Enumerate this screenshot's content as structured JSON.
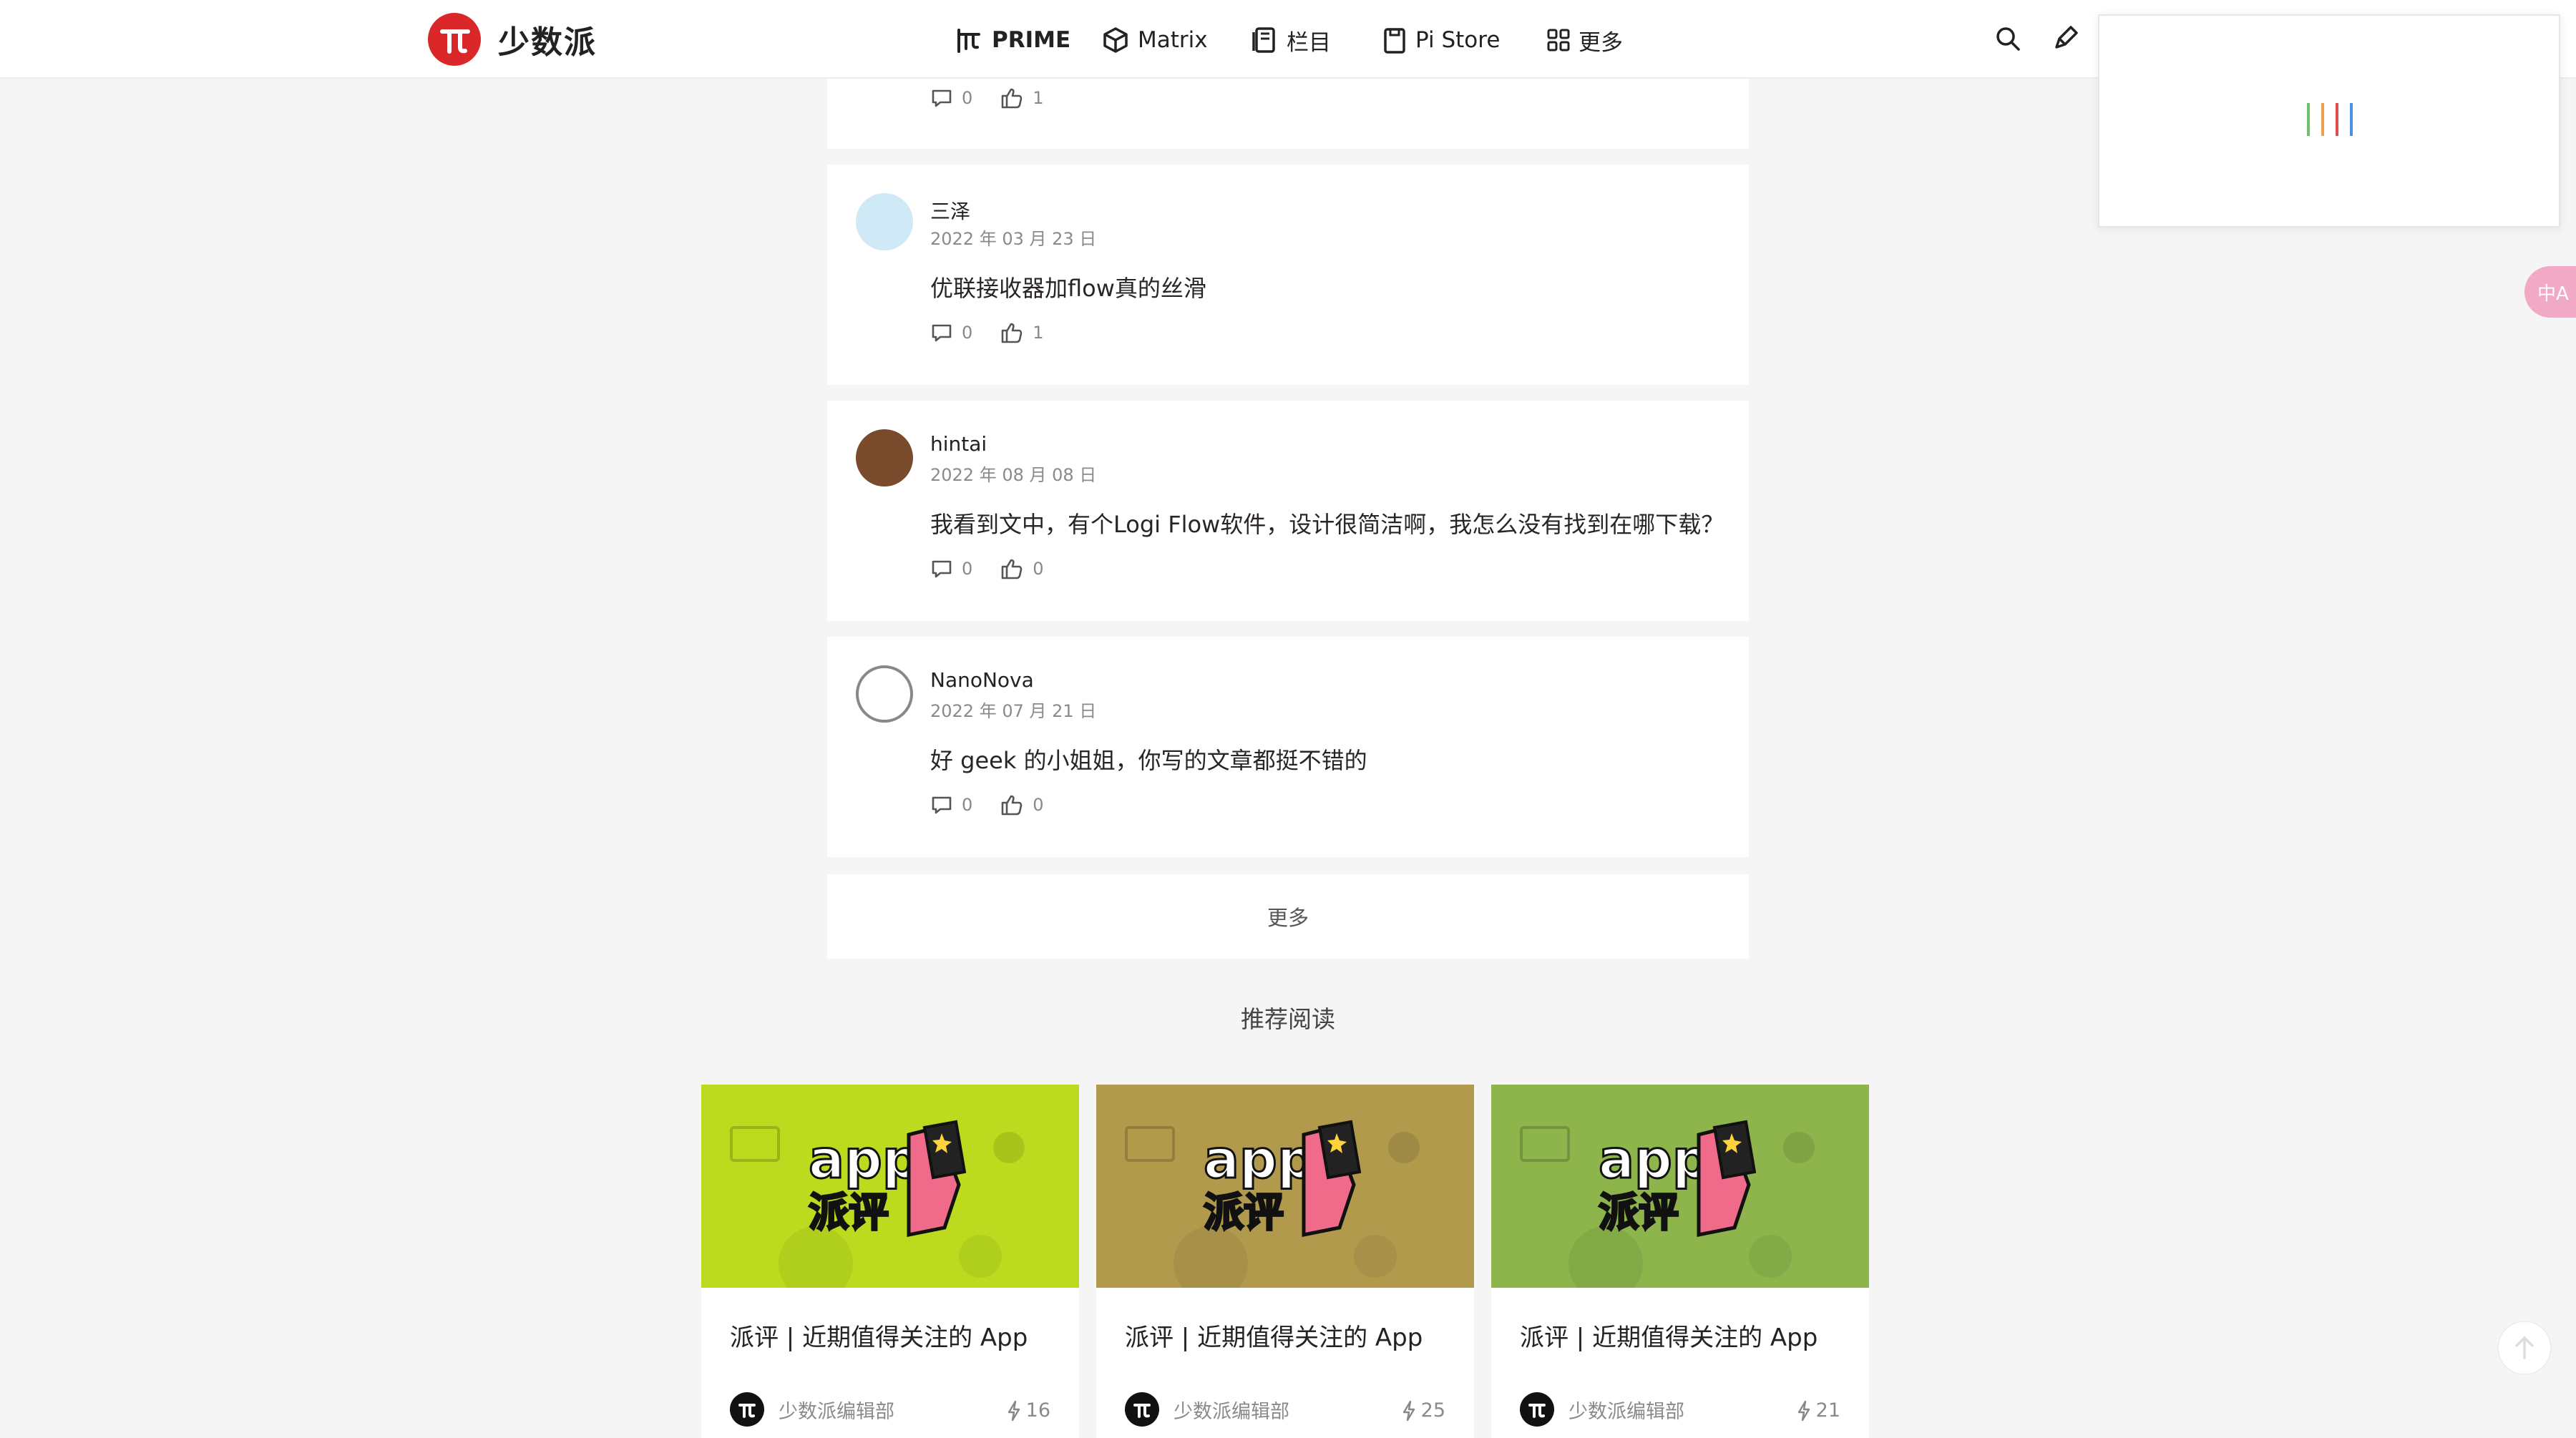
{
  "brand": {
    "name": "少数派"
  },
  "nav": [
    {
      "label": "PRIME",
      "icon": "prime-icon"
    },
    {
      "label": "Matrix",
      "icon": "matrix-cube-icon"
    },
    {
      "label": "栏目",
      "icon": "column-book-icon"
    },
    {
      "label": "Pi Store",
      "icon": "store-bag-icon"
    },
    {
      "label": "更多",
      "icon": "grid-icon"
    }
  ],
  "header_icons": [
    "search-icon",
    "pen-write-icon"
  ],
  "loader_colors": [
    "#6cbf6b",
    "#f0a04b",
    "#e24b4b",
    "#4b8fe2"
  ],
  "translate": {
    "label": "中A"
  },
  "top_partial_comment": {
    "replies": "0",
    "likes": "1"
  },
  "comments": [
    {
      "name": "三泽",
      "date": "2022 年 03 月 23 日",
      "text": "优联接收器加flow真的丝滑",
      "replies": "0",
      "likes": "1",
      "avatar": "avatar-light-blue"
    },
    {
      "name": "hintai",
      "date": "2022 年 08 月 08 日",
      "text": "我看到文中，有个Logi Flow软件，设计很简洁啊，我怎么没有找到在哪下载？",
      "replies": "0",
      "likes": "0",
      "avatar": "avatar-animal-photo"
    },
    {
      "name": "NanoNova",
      "date": "2022 年 07 月 21 日",
      "text": "好 geek 的小姐姐，你写的文章都挺不错的",
      "replies": "0",
      "likes": "0",
      "avatar": "avatar-circle-outline"
    }
  ],
  "more_button": "更多",
  "recommend": {
    "title": "推荐阅读",
    "items": [
      {
        "title": "派评 | 近期值得关注的 App",
        "author": "少数派编辑部",
        "count": "16",
        "bg": "#bcdb1e",
        "cover_big": "app",
        "cover_small": "派评"
      },
      {
        "title": "派评 | 近期值得关注的 App",
        "author": "少数派编辑部",
        "count": "25",
        "bg": "#b29a4d",
        "cover_big": "app",
        "cover_small": "派评"
      },
      {
        "title": "派评 | 近期值得关注的 App",
        "author": "少数派编辑部",
        "count": "21",
        "bg": "#8db54c",
        "cover_big": "app",
        "cover_small": "派评"
      }
    ]
  }
}
